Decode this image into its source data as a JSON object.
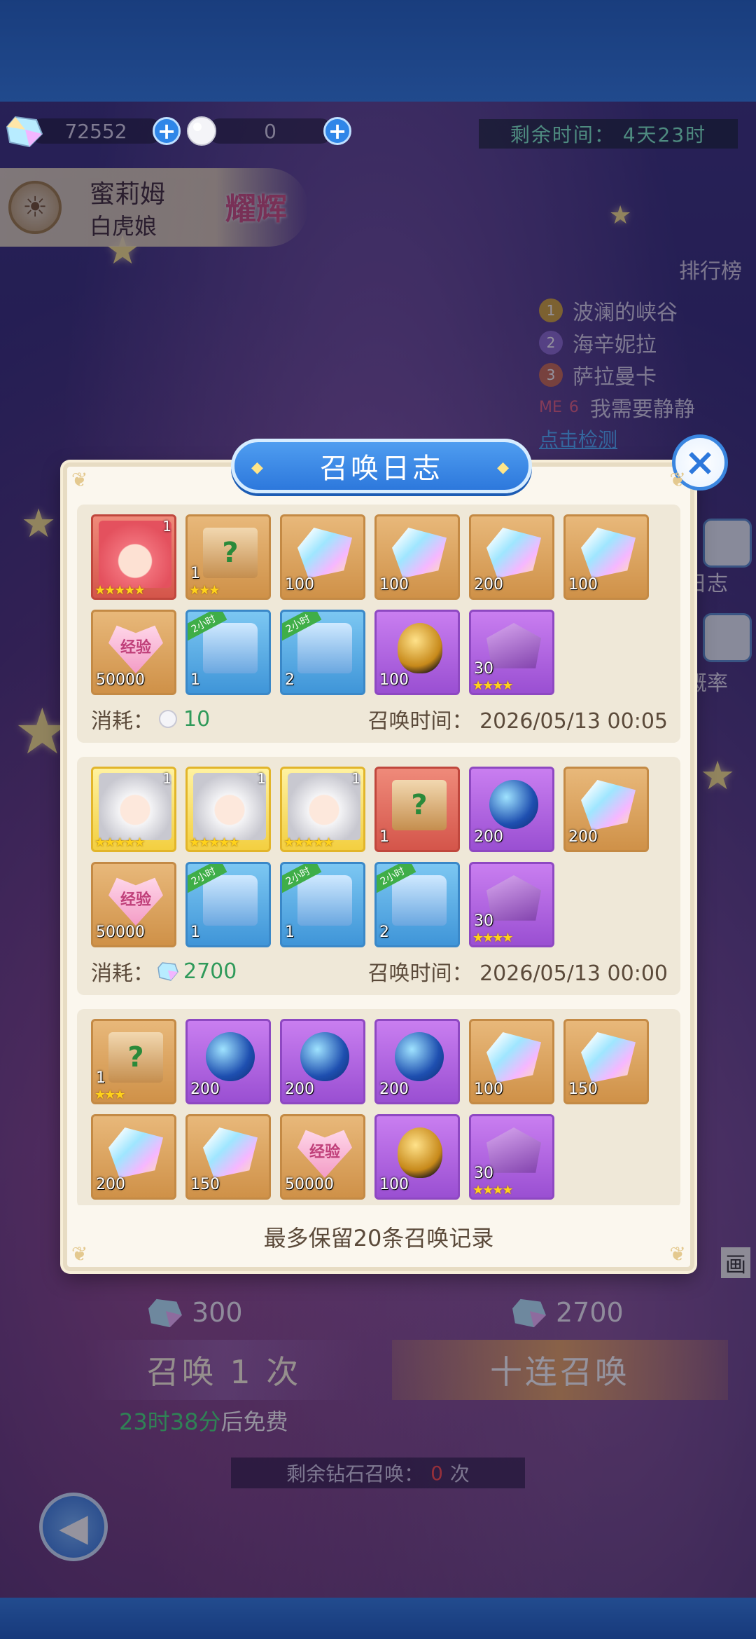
{
  "currency": {
    "gems": "72552",
    "pearls": "0"
  },
  "remaining_time": "剩余时间：  4天23时",
  "character": {
    "name": "蜜莉姆",
    "title": "白虎娘",
    "badge": "耀辉"
  },
  "leaderboard": {
    "header": "排行榜",
    "rows": [
      {
        "rank": "1",
        "name": "波澜的峡谷"
      },
      {
        "rank": "2",
        "name": "海辛妮拉"
      },
      {
        "rank": "3",
        "name": "萨拉曼卡"
      }
    ],
    "me_label": "ME",
    "me_rank": "6",
    "me_name": "我需要静静",
    "link": "点击检测"
  },
  "side": {
    "log": "日志",
    "rate": "概率",
    "anim": "画"
  },
  "bottom": {
    "single_cost": "300",
    "ten_cost": "2700",
    "single_label": "召唤 1 次",
    "ten_label": "十连召唤",
    "free_time": "23时38分",
    "free_suffix": "后免费",
    "diamond_prefix": "剩余钻石召唤：",
    "diamond_count": "0",
    "diamond_suffix": "次"
  },
  "modal": {
    "title": "召唤日志",
    "close": "×",
    "note": "最多保留20条召唤记录",
    "records": [
      {
        "cost_label": "消耗：",
        "cost_value": "10",
        "time": "召唤时间：  2026/05/13 00:05",
        "items": [
          {
            "qty": "1",
            "stars": "★★★★★"
          },
          {
            "qty": "1",
            "stars": "★★★"
          },
          {
            "qty": "100"
          },
          {
            "qty": "100"
          },
          {
            "qty": "200"
          },
          {
            "qty": "100"
          },
          {
            "qty": "50000",
            "label": "经验"
          },
          {
            "qty": "1",
            "tag": "2小时"
          },
          {
            "qty": "2",
            "tag": "2小时"
          },
          {
            "qty": "100"
          },
          {
            "qty": "30",
            "stars": "★★★★"
          }
        ]
      },
      {
        "cost_label": "消耗：",
        "cost_value": "2700",
        "time": "召唤时间：  2026/05/13 00:00",
        "items": [
          {
            "corner": "1",
            "stars": "★★★★★"
          },
          {
            "corner": "1",
            "stars": "★★★★★"
          },
          {
            "corner": "1",
            "stars": "★★★★★"
          },
          {
            "qty": "1"
          },
          {
            "qty": "200"
          },
          {
            "qty": "200"
          },
          {
            "qty": "50000",
            "label": "经验"
          },
          {
            "qty": "1",
            "tag": "2小时"
          },
          {
            "qty": "1",
            "tag": "2小时"
          },
          {
            "qty": "2",
            "tag": "2小时"
          },
          {
            "qty": "30",
            "stars": "★★★★"
          }
        ]
      },
      {
        "items": [
          {
            "qty": "1",
            "stars": "★★★"
          },
          {
            "qty": "200"
          },
          {
            "qty": "200"
          },
          {
            "qty": "200"
          },
          {
            "qty": "100"
          },
          {
            "qty": "150"
          },
          {
            "qty": "200"
          },
          {
            "qty": "150"
          },
          {
            "qty": "50000",
            "label": "经验"
          },
          {
            "qty": "100"
          },
          {
            "qty": "30",
            "stars": "★★★★"
          }
        ]
      }
    ]
  },
  "colors": {
    "accent_blue": "#2d78dc",
    "cost_green": "#2f9a5a",
    "free_green": "#45e07a",
    "warn_red": "#ff4a4a"
  }
}
